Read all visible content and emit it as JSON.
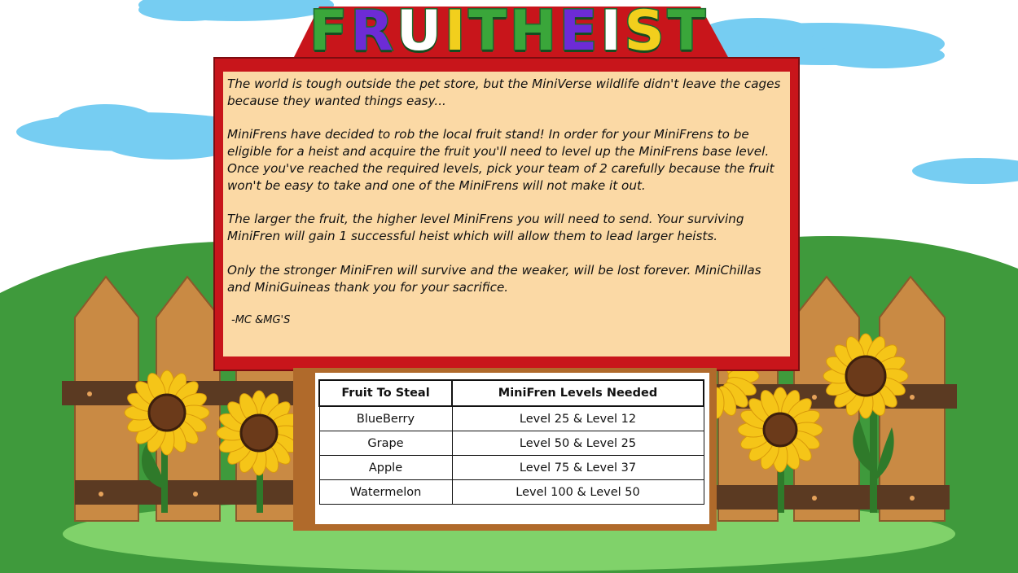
{
  "title": {
    "letters": [
      "F",
      "R",
      "U",
      "I",
      "T",
      "H",
      "E",
      "I",
      "S",
      "T"
    ],
    "letter_colors": [
      "#3aa63a",
      "#6d2bd6",
      "#ffffff",
      "#f2cf1d",
      "#3aa63a",
      "#3aa63a",
      "#6d2bd6",
      "#ffffff",
      "#f2cf1d",
      "#3aa63a"
    ]
  },
  "story": {
    "paragraph_1": "The world is tough outside the pet store, but the MiniVerse wildlife didn't leave the cages because they wanted things easy...",
    "paragraph_2": "MiniFrens have decided to rob the local fruit stand! In order for your MiniFrens to be eligible for a heist and acquire the fruit you'll need to level up the MiniFrens base level. Once you've reached the required levels, pick your team of 2 carefully because the fruit won't be easy to take and one of the MiniFrens will not make it out.",
    "paragraph_3": "The larger the fruit, the higher level MiniFrens you will need to send. Your surviving MiniFren will gain 1 successful heist which will allow them to lead larger heists.",
    "paragraph_4": "Only the stronger MiniFren will survive and the weaker, will be lost forever. MiniChillas and MiniGuineas thank you for your sacrifice.",
    "signature": "-MC &MG'S"
  },
  "table": {
    "headers": [
      "Fruit To Steal",
      "MiniFren Levels Needed"
    ],
    "rows": [
      [
        "BlueBerry",
        "Level 25 & Level 12"
      ],
      [
        "Grape",
        "Level 50 & Level 25"
      ],
      [
        "Apple",
        "Level 75 & Level 37"
      ],
      [
        "Watermelon",
        "Level 100 & Level 50"
      ]
    ]
  },
  "colors": {
    "sky_cloud": "#76cdf2",
    "hill_dark": "#3f9a3c",
    "hill_light": "#80d26a",
    "fence_wood": "#c98a44",
    "fence_rail": "#5b3a22",
    "sign_red": "#c8151b",
    "paper": "#fbd9a5",
    "sunflower_petal": "#f5c518",
    "sunflower_center": "#6b3a1a"
  }
}
